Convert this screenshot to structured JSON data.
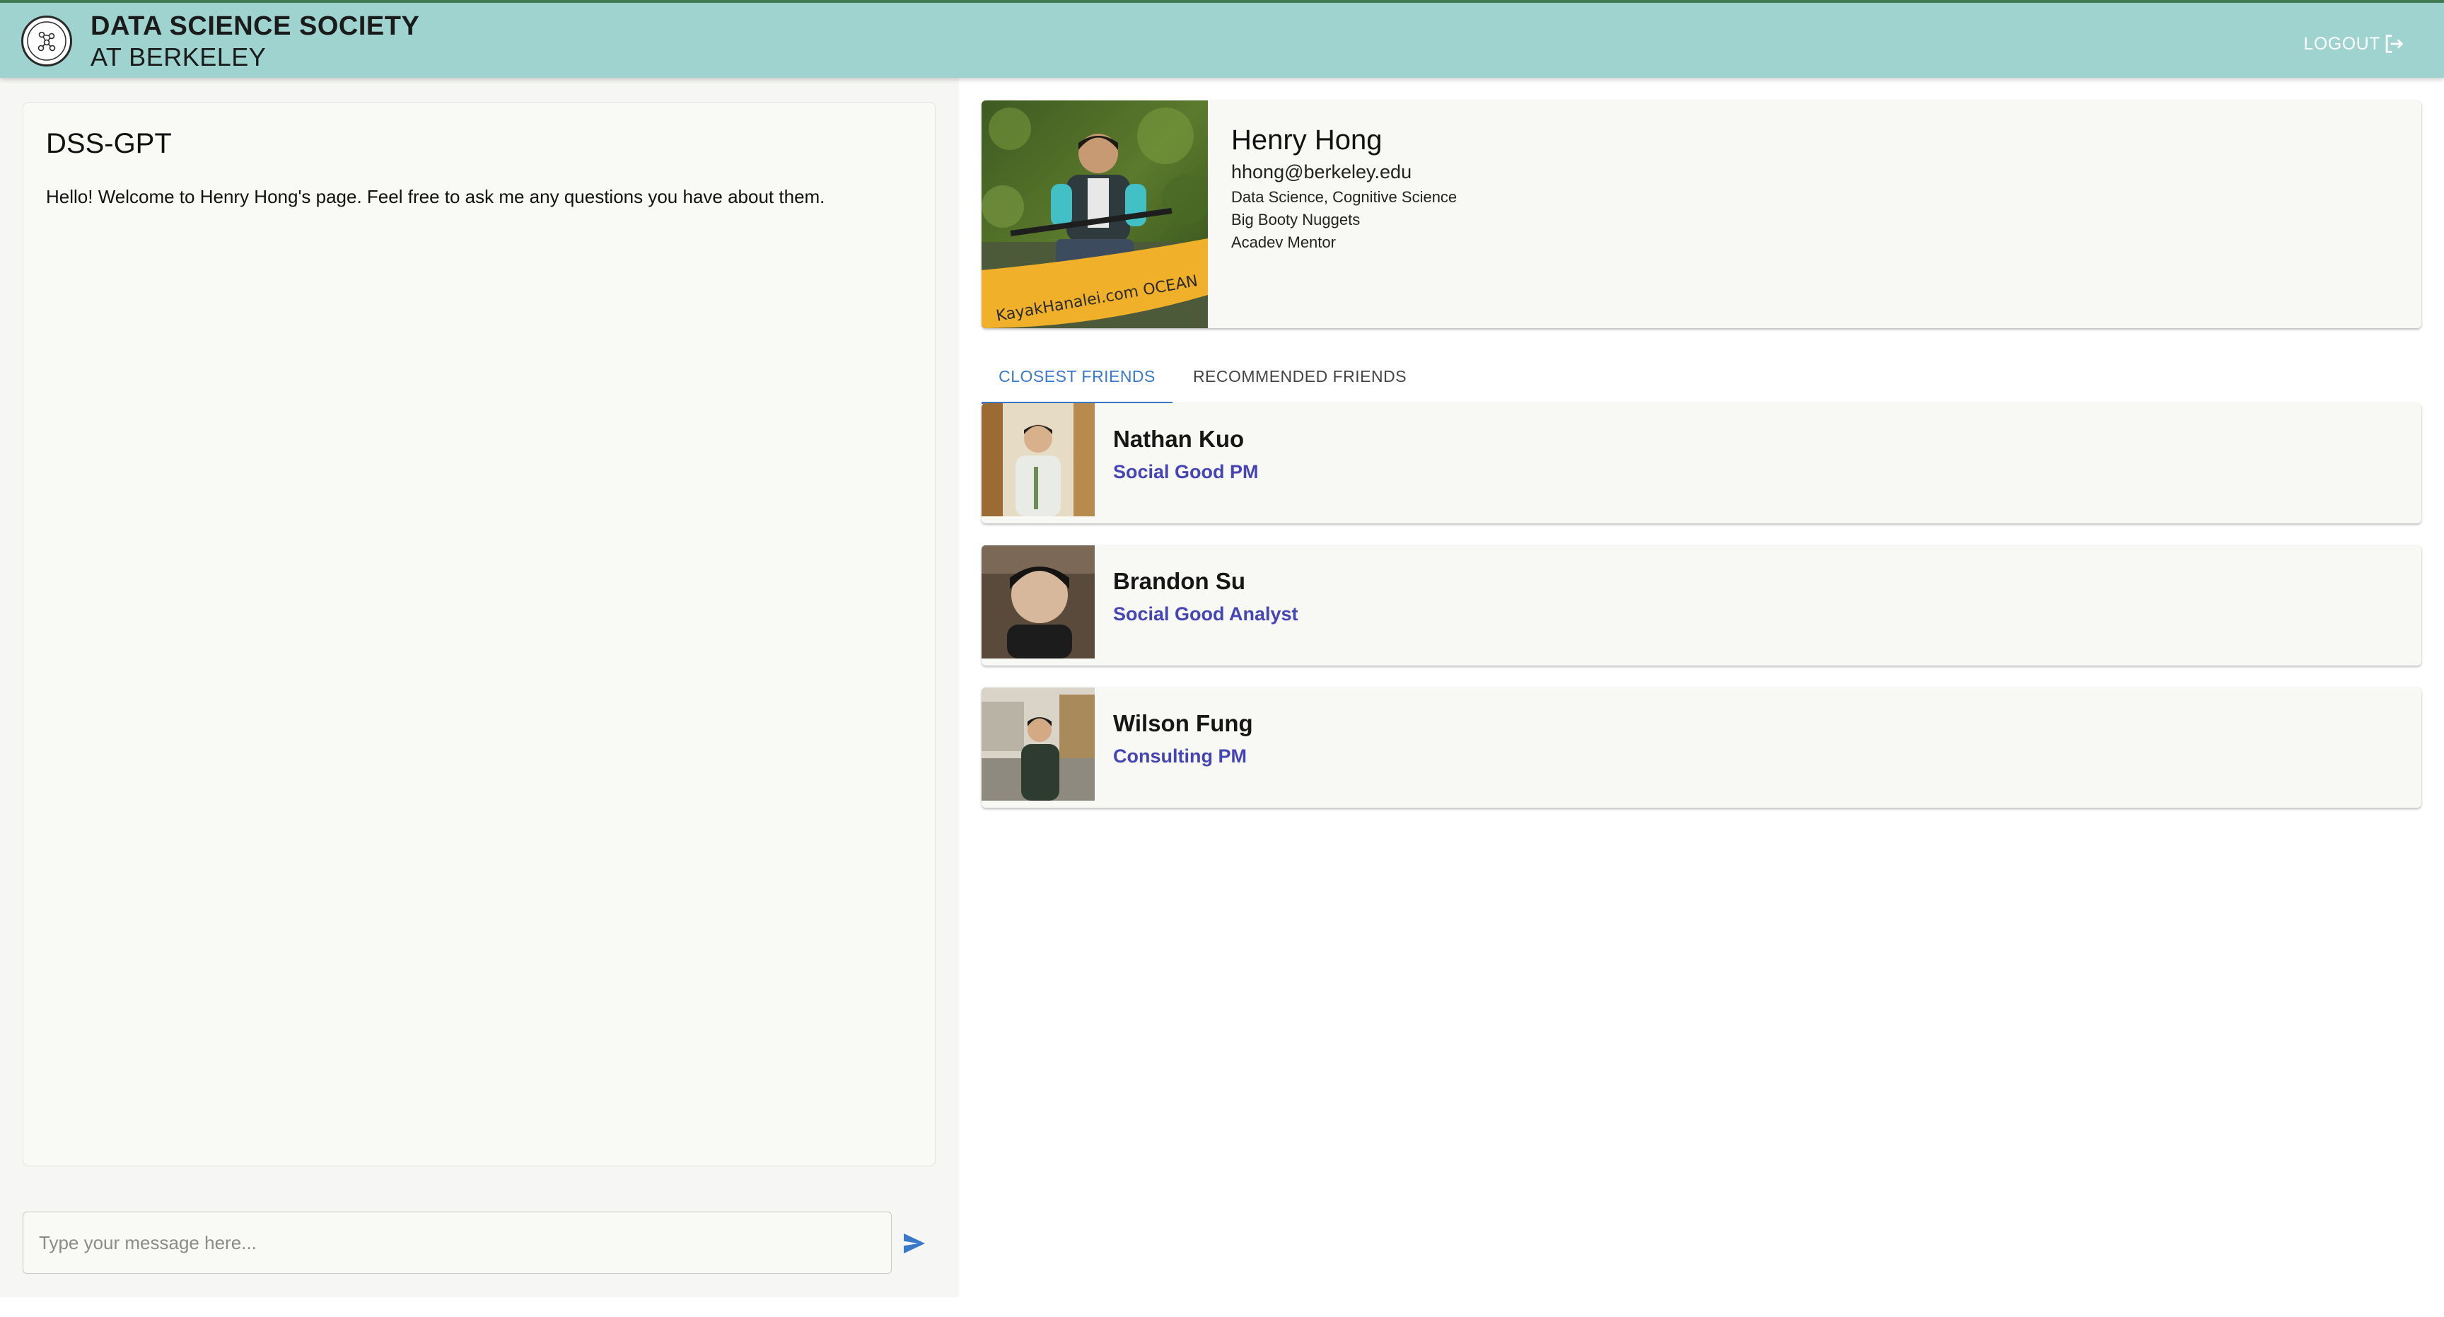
{
  "header": {
    "brand_line1": "DATA SCIENCE SOCIETY",
    "brand_line2": "AT BERKELEY",
    "logout_label": "LOGOUT",
    "bg_color": "#9fd3cf"
  },
  "chat": {
    "title": "DSS-GPT",
    "messages": [
      {
        "text": "Hello! Welcome to Henry Hong's page. Feel free to ask me any questions you have about them."
      }
    ],
    "input_placeholder": "Type your message here...",
    "input_value": "",
    "send_icon": "send-icon"
  },
  "profile": {
    "name": "Henry Hong",
    "email": "hhong@berkeley.edu",
    "majors": "Data Science, Cognitive Science",
    "team": "Big Booty Nuggets",
    "role": "Acadev Mentor",
    "photo_caption": "KayakHanalei.com OCEAN"
  },
  "tabs": [
    {
      "label": "CLOSEST FRIENDS",
      "active": true
    },
    {
      "label": "RECOMMENDED FRIENDS",
      "active": false
    }
  ],
  "friends": [
    {
      "name": "Nathan Kuo",
      "role": "Social Good PM"
    },
    {
      "name": "Brandon Su",
      "role": "Social Good Analyst"
    },
    {
      "name": "Wilson Fung",
      "role": "Consulting PM"
    }
  ],
  "colors": {
    "accent_blue": "#3a78c9",
    "role_text": "#4545b5",
    "card_bg": "#f8f8f4"
  }
}
